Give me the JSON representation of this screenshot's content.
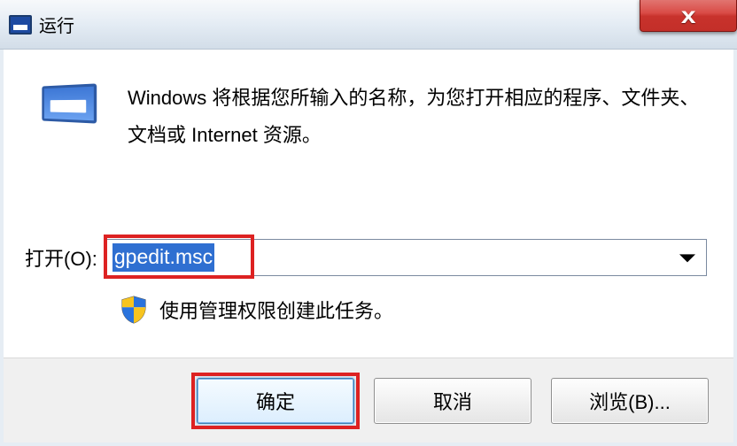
{
  "title": "运行",
  "description": "Windows 将根据您所输入的名称，为您打开相应的程序、文件夹、文档或 Internet 资源。",
  "open_label": "打开(O):",
  "open_value": "gpedit.msc",
  "admin_note": "使用管理权限创建此任务。",
  "buttons": {
    "ok": "确定",
    "cancel": "取消",
    "browse": "浏览(B)..."
  },
  "close_glyph": "x"
}
